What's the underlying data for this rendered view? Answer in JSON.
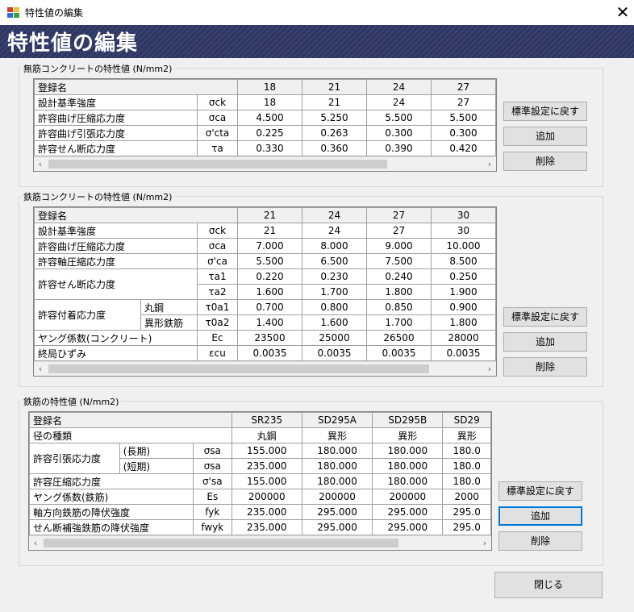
{
  "window": {
    "title": "特性値の編集",
    "banner": "特性値の編集"
  },
  "group1": {
    "label": "無筋コンクリートの特性値 (N/mm2)",
    "header": {
      "label": "登録名",
      "cols": [
        "18",
        "21",
        "24",
        "27"
      ]
    },
    "rows": [
      {
        "name": "設計基準強度",
        "sym": "σck",
        "vals": [
          "18",
          "21",
          "24",
          "27"
        ]
      },
      {
        "name": "許容曲げ圧縮応力度",
        "sym": "σca",
        "vals": [
          "4.500",
          "5.250",
          "5.500",
          "5.500"
        ]
      },
      {
        "name": "許容曲げ引張応力度",
        "sym": "σ'cta",
        "vals": [
          "0.225",
          "0.263",
          "0.300",
          "0.300"
        ]
      },
      {
        "name": "許容せん断応力度",
        "sym": "τa",
        "vals": [
          "0.330",
          "0.360",
          "0.390",
          "0.420"
        ]
      }
    ]
  },
  "group2": {
    "label": "鉄筋コンクリートの特性値 (N/mm2)",
    "header": {
      "label": "登録名",
      "cols": [
        "21",
        "24",
        "27",
        "30"
      ]
    },
    "rows": [
      {
        "name": "設計基準強度",
        "sym": "σck",
        "vals": [
          "21",
          "24",
          "27",
          "30"
        ]
      },
      {
        "name": "許容曲げ圧縮応力度",
        "sym": "σca",
        "vals": [
          "7.000",
          "8.000",
          "9.000",
          "10.000"
        ]
      },
      {
        "name": "許容軸圧縮応力度",
        "sym": "σ'ca",
        "vals": [
          "5.500",
          "6.500",
          "7.500",
          "8.500"
        ]
      }
    ],
    "shear": {
      "name": "許容せん断応力度",
      "rows": [
        {
          "sym": "τa1",
          "vals": [
            "0.220",
            "0.230",
            "0.240",
            "0.250"
          ]
        },
        {
          "sym": "τa2",
          "vals": [
            "1.600",
            "1.700",
            "1.800",
            "1.900"
          ]
        }
      ]
    },
    "bond": {
      "name": "許容付着応力度",
      "rows": [
        {
          "sub": "丸鋼",
          "sym": "τ0a1",
          "vals": [
            "0.700",
            "0.800",
            "0.850",
            "0.900"
          ]
        },
        {
          "sub": "異形鉄筋",
          "sym": "τ0a2",
          "vals": [
            "1.400",
            "1.600",
            "1.700",
            "1.800"
          ]
        }
      ]
    },
    "rows2": [
      {
        "name": "ヤング係数(コンクリート)",
        "sym": "Ec",
        "vals": [
          "23500",
          "25000",
          "26500",
          "28000"
        ]
      },
      {
        "name": "終局ひずみ",
        "sym": "εcu",
        "vals": [
          "0.0035",
          "0.0035",
          "0.0035",
          "0.0035"
        ]
      }
    ]
  },
  "group3": {
    "label": "鉄筋の特性値 (N/mm2)",
    "header": {
      "label": "登録名",
      "cols": [
        "SR235",
        "SD295A",
        "SD295B",
        "SD29"
      ]
    },
    "type_row": {
      "name": "径の種類",
      "vals": [
        "丸鋼",
        "異形",
        "異形",
        "異形"
      ]
    },
    "tension": {
      "name": "許容引張応力度",
      "rows": [
        {
          "sub": "(長期)",
          "sym": "σsa",
          "vals": [
            "155.000",
            "180.000",
            "180.000",
            "180.0"
          ]
        },
        {
          "sub": "(短期)",
          "sym": "σsa",
          "vals": [
            "235.000",
            "180.000",
            "180.000",
            "180.0"
          ]
        }
      ]
    },
    "rows": [
      {
        "name": "許容圧縮応力度",
        "sym": "σ'sa",
        "vals": [
          "155.000",
          "180.000",
          "180.000",
          "180.0"
        ]
      },
      {
        "name": "ヤング係数(鉄筋)",
        "sym": "Es",
        "vals": [
          "200000",
          "200000",
          "200000",
          "2000"
        ]
      },
      {
        "name": "軸方向鉄筋の降伏強度",
        "sym": "fyk",
        "vals": [
          "235.000",
          "295.000",
          "295.000",
          "295.0"
        ]
      },
      {
        "name": "せん断補強鉄筋の降伏強度",
        "sym": "fwyk",
        "vals": [
          "235.000",
          "295.000",
          "295.000",
          "295.0"
        ]
      }
    ]
  },
  "buttons": {
    "reset": "標準設定に戻す",
    "add": "追加",
    "delete": "削除",
    "close": "閉じる"
  },
  "scroll": {
    "left": "‹",
    "right": "›"
  },
  "icons": {
    "close": "✕"
  },
  "colors": {
    "banner": "#2e3763",
    "focus": "#0078d7"
  }
}
